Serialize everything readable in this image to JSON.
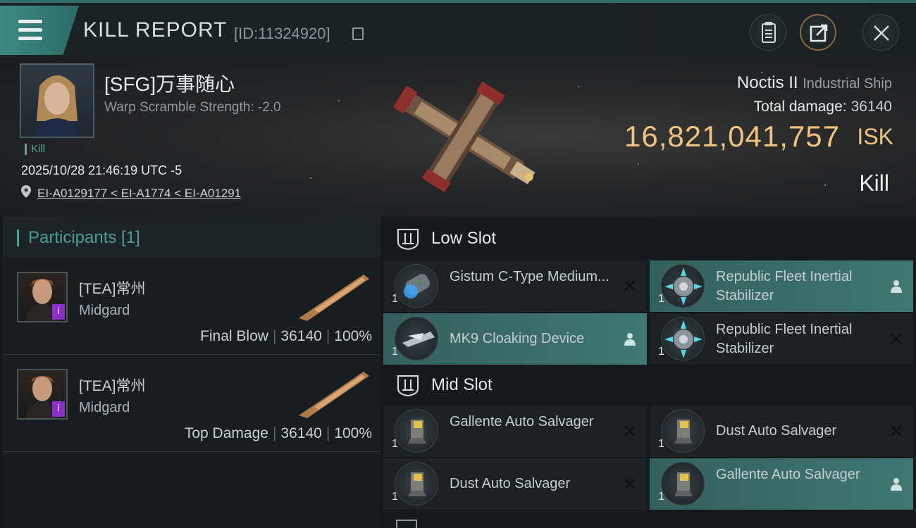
{
  "header": {
    "title": "KILL REPORT",
    "report_id": "[ID:11324920]",
    "icons": [
      "menu-icon",
      "copy-icon",
      "clipboard-icon",
      "share-icon",
      "close-icon"
    ]
  },
  "victim": {
    "name": "[SFG]万事随心",
    "warp_scramble": "Warp Scramble Strength: -2.0",
    "tag": "Kill",
    "datetime": "2025/10/28 21:46:19 UTC -5",
    "location": "EI-A0129177 < EI-A1774 < EI-A01291"
  },
  "ship": {
    "name": "Noctis II",
    "class": "Industrial Ship",
    "total_damage_label": "Total damage:",
    "total_damage": "36140",
    "isk_value": "16,821,041,757",
    "isk_unit": "ISK",
    "result": "Kill"
  },
  "participants": {
    "title": "Participants [1]",
    "rows": [
      {
        "name": "[TEA]常州",
        "ship": "Midgard",
        "role": "Final Blow",
        "damage": "36140",
        "percent": "100%"
      },
      {
        "name": "[TEA]常州",
        "ship": "Midgard",
        "role": "Top Damage",
        "damage": "36140",
        "percent": "100%"
      }
    ]
  },
  "fitting": {
    "low_slot": {
      "title": "Low Slot",
      "modules": [
        {
          "name": "Gistum C-Type Medium...",
          "qty": "1",
          "status": "destroyed"
        },
        {
          "name": "Republic Fleet Inertial Stabilizer",
          "qty": "1",
          "status": "dropped"
        },
        {
          "name": "MK9 Cloaking Device",
          "qty": "1",
          "status": "dropped"
        },
        {
          "name": "Republic Fleet Inertial Stabilizer",
          "qty": "1",
          "status": "destroyed"
        }
      ]
    },
    "mid_slot": {
      "title": "Mid Slot",
      "modules": [
        {
          "name": "Gallente Auto Salvager",
          "qty": "1",
          "status": "destroyed"
        },
        {
          "name": "Dust Auto Salvager",
          "qty": "1",
          "status": "destroyed"
        },
        {
          "name": "Dust Auto Salvager",
          "qty": "1",
          "status": "destroyed"
        },
        {
          "name": "Gallente Auto Salvager",
          "qty": "1",
          "status": "dropped"
        }
      ]
    }
  },
  "colors": {
    "accent": "#4e9e96",
    "isk": "#f0c47a",
    "fitted_row": "#3f7873",
    "badge": "#8b2fc9"
  }
}
